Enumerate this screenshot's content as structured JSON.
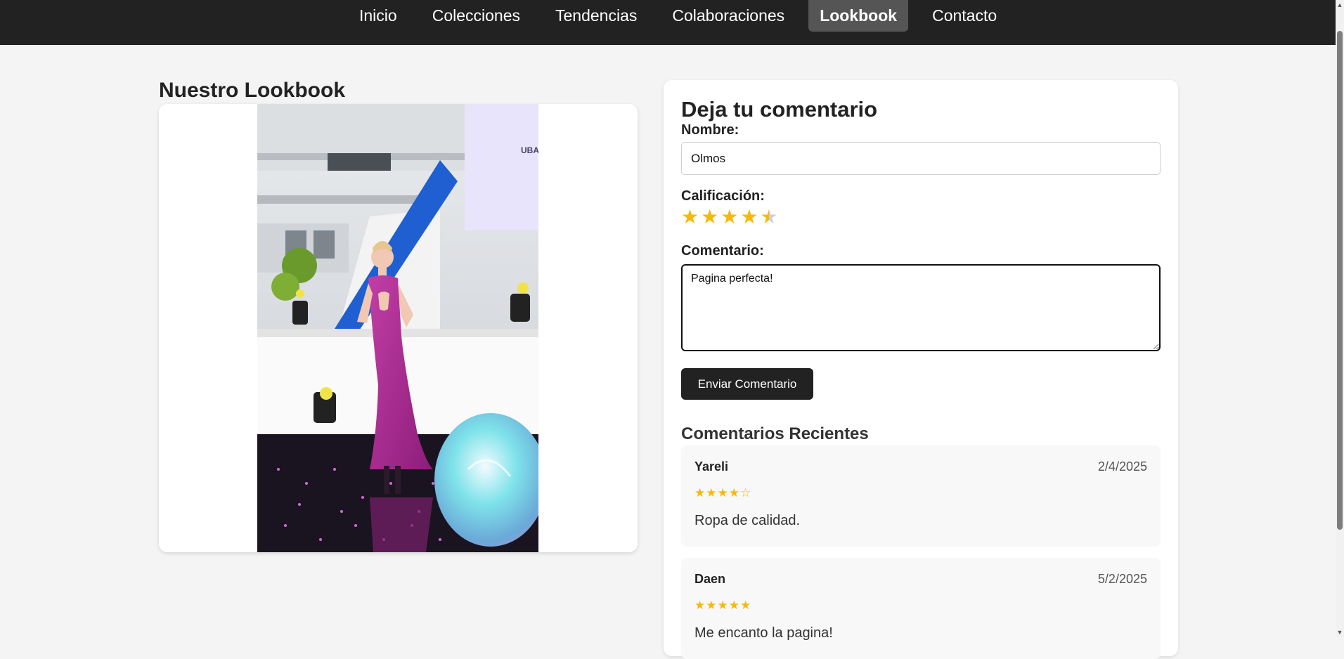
{
  "nav": {
    "items": [
      {
        "label": "Inicio",
        "active": false
      },
      {
        "label": "Colecciones",
        "active": false
      },
      {
        "label": "Tendencias",
        "active": false
      },
      {
        "label": "Colaboraciones",
        "active": false
      },
      {
        "label": "Lookbook",
        "active": true
      },
      {
        "label": "Contacto",
        "active": false
      }
    ]
  },
  "lookbook": {
    "title": "Nuestro Lookbook"
  },
  "form": {
    "title": "Deja tu comentario",
    "name_label": "Nombre:",
    "name_value": "Olmos",
    "rating_label": "Calificación:",
    "rating_value": 4.5,
    "rating_max": 5,
    "comment_label": "Comentario:",
    "comment_value": "Pagina perfecta!",
    "submit_label": "Enviar Comentario"
  },
  "recent": {
    "title": "Comentarios Recientes",
    "comments": [
      {
        "author": "Yareli",
        "date": "2/4/2025",
        "stars": "★★★★☆",
        "text": "Ropa de calidad."
      },
      {
        "author": "Daen",
        "date": "5/2/2025",
        "stars": "★★★★★",
        "text": "Me encanto la pagina!"
      }
    ]
  },
  "colors": {
    "nav_bg": "#222222",
    "nav_active_bg": "#555555",
    "star": "#f5b90b",
    "button_bg": "#222222",
    "page_bg": "#f4f4f4"
  },
  "icons": {
    "star": "star-icon",
    "scroll_up": "caret-up-icon",
    "scroll_down": "caret-down-icon"
  }
}
